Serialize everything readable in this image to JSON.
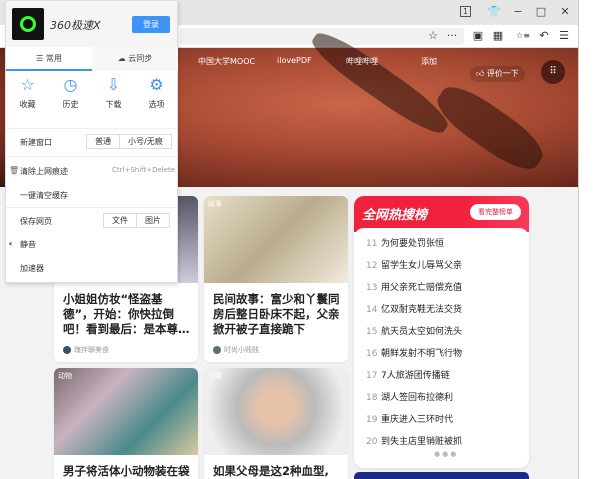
{
  "window": {
    "tab_count": "1",
    "minimize": "−",
    "maximize": "□",
    "close": "✕",
    "skin": "👕"
  },
  "toolbar": {
    "star": "☆",
    "more": "···",
    "sidebar": "▣",
    "apps": "▦",
    "favorites": "☆≡",
    "undo": "↶",
    "menu": "☰"
  },
  "bookmarks": [
    "中国大学MOOC",
    "ilovePDF",
    "哔哩哔哩",
    "添加"
  ],
  "hero": {
    "rate_label": "评价一下",
    "apps": "⠿"
  },
  "popup": {
    "brand": "360极速X",
    "login": "登录",
    "tabs": [
      "常用",
      "云同步"
    ],
    "quick": [
      {
        "icon": "☆",
        "label": "收藏"
      },
      {
        "icon": "◷",
        "label": "历史"
      },
      {
        "icon": "⇩",
        "label": "下载"
      },
      {
        "icon": "⚙",
        "label": "选项"
      }
    ],
    "new_window": {
      "label": "新建窗口",
      "options": [
        "普通",
        "小号/无痕"
      ]
    },
    "clear_history": {
      "label": "清除上网痕迹",
      "shortcut": "Ctrl+Shift+Delete"
    },
    "clear_cache": "一键清空缓存",
    "save_page": {
      "label": "保存网页",
      "options": [
        "文件",
        "图片"
      ]
    },
    "mute": "静音",
    "accelerator": "加速器"
  },
  "cards": [
    {
      "tag": "",
      "title": "小姐姐仿妆“怪盗基德”，开始：你快拉倒吧！看到最后：是本尊…",
      "source": "瑰拌聊美食"
    },
    {
      "tag": "故事",
      "title": "民间故事：富少和丫鬟同房后整日卧床不起，父亲掀开被子直接跪下",
      "source": "时尚小贱贱"
    },
    {
      "tag": "动物",
      "title": "男子将活体小动物装在袋",
      "source": ""
    },
    {
      "tag": "母婴",
      "title": "如果父母是这2种血型,",
      "source": ""
    }
  ],
  "hot": {
    "title": "全网热搜榜",
    "more": "看完整榜单",
    "items": [
      {
        "n": "11",
        "t": "为何要处罚张恒"
      },
      {
        "n": "12",
        "t": "留学生女儿辱骂父亲"
      },
      {
        "n": "13",
        "t": "用父亲死亡赔偿充值"
      },
      {
        "n": "14",
        "t": "亿双耐克鞋无法交货"
      },
      {
        "n": "15",
        "t": "航天员太空如何洗头"
      },
      {
        "n": "16",
        "t": "朝鲜发射不明飞行物"
      },
      {
        "n": "17",
        "t": "7人旅游团传播链"
      },
      {
        "n": "18",
        "t": "湖人签回布拉德利"
      },
      {
        "n": "19",
        "t": "重庆进入三环时代"
      },
      {
        "n": "20",
        "t": "到失主店里销赃被抓"
      }
    ],
    "dots": "●●●"
  }
}
